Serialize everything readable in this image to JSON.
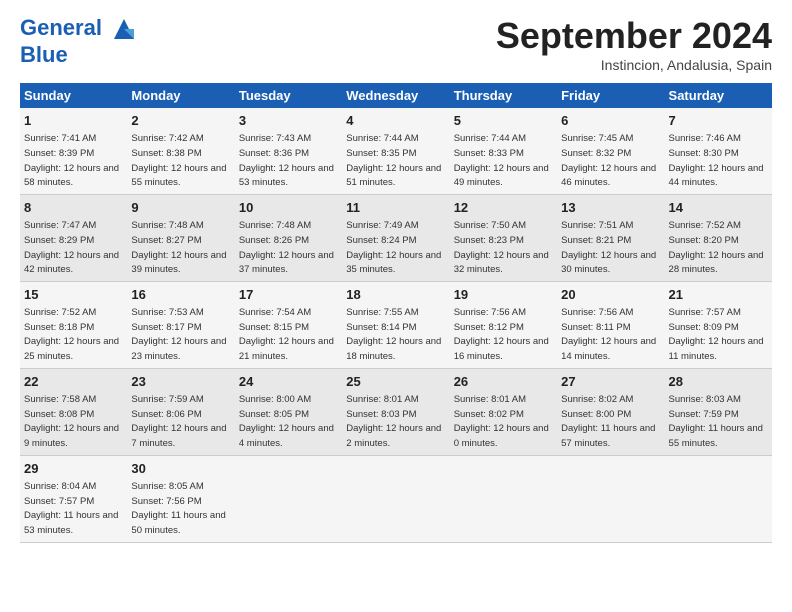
{
  "header": {
    "logo_line1": "General",
    "logo_line2": "Blue",
    "month": "September 2024",
    "location": "Instincion, Andalusia, Spain"
  },
  "days_of_week": [
    "Sunday",
    "Monday",
    "Tuesday",
    "Wednesday",
    "Thursday",
    "Friday",
    "Saturday"
  ],
  "weeks": [
    [
      {
        "day": "1",
        "sunrise": "Sunrise: 7:41 AM",
        "sunset": "Sunset: 8:39 PM",
        "daylight": "Daylight: 12 hours and 58 minutes."
      },
      {
        "day": "2",
        "sunrise": "Sunrise: 7:42 AM",
        "sunset": "Sunset: 8:38 PM",
        "daylight": "Daylight: 12 hours and 55 minutes."
      },
      {
        "day": "3",
        "sunrise": "Sunrise: 7:43 AM",
        "sunset": "Sunset: 8:36 PM",
        "daylight": "Daylight: 12 hours and 53 minutes."
      },
      {
        "day": "4",
        "sunrise": "Sunrise: 7:44 AM",
        "sunset": "Sunset: 8:35 PM",
        "daylight": "Daylight: 12 hours and 51 minutes."
      },
      {
        "day": "5",
        "sunrise": "Sunrise: 7:44 AM",
        "sunset": "Sunset: 8:33 PM",
        "daylight": "Daylight: 12 hours and 49 minutes."
      },
      {
        "day": "6",
        "sunrise": "Sunrise: 7:45 AM",
        "sunset": "Sunset: 8:32 PM",
        "daylight": "Daylight: 12 hours and 46 minutes."
      },
      {
        "day": "7",
        "sunrise": "Sunrise: 7:46 AM",
        "sunset": "Sunset: 8:30 PM",
        "daylight": "Daylight: 12 hours and 44 minutes."
      }
    ],
    [
      {
        "day": "8",
        "sunrise": "Sunrise: 7:47 AM",
        "sunset": "Sunset: 8:29 PM",
        "daylight": "Daylight: 12 hours and 42 minutes."
      },
      {
        "day": "9",
        "sunrise": "Sunrise: 7:48 AM",
        "sunset": "Sunset: 8:27 PM",
        "daylight": "Daylight: 12 hours and 39 minutes."
      },
      {
        "day": "10",
        "sunrise": "Sunrise: 7:48 AM",
        "sunset": "Sunset: 8:26 PM",
        "daylight": "Daylight: 12 hours and 37 minutes."
      },
      {
        "day": "11",
        "sunrise": "Sunrise: 7:49 AM",
        "sunset": "Sunset: 8:24 PM",
        "daylight": "Daylight: 12 hours and 35 minutes."
      },
      {
        "day": "12",
        "sunrise": "Sunrise: 7:50 AM",
        "sunset": "Sunset: 8:23 PM",
        "daylight": "Daylight: 12 hours and 32 minutes."
      },
      {
        "day": "13",
        "sunrise": "Sunrise: 7:51 AM",
        "sunset": "Sunset: 8:21 PM",
        "daylight": "Daylight: 12 hours and 30 minutes."
      },
      {
        "day": "14",
        "sunrise": "Sunrise: 7:52 AM",
        "sunset": "Sunset: 8:20 PM",
        "daylight": "Daylight: 12 hours and 28 minutes."
      }
    ],
    [
      {
        "day": "15",
        "sunrise": "Sunrise: 7:52 AM",
        "sunset": "Sunset: 8:18 PM",
        "daylight": "Daylight: 12 hours and 25 minutes."
      },
      {
        "day": "16",
        "sunrise": "Sunrise: 7:53 AM",
        "sunset": "Sunset: 8:17 PM",
        "daylight": "Daylight: 12 hours and 23 minutes."
      },
      {
        "day": "17",
        "sunrise": "Sunrise: 7:54 AM",
        "sunset": "Sunset: 8:15 PM",
        "daylight": "Daylight: 12 hours and 21 minutes."
      },
      {
        "day": "18",
        "sunrise": "Sunrise: 7:55 AM",
        "sunset": "Sunset: 8:14 PM",
        "daylight": "Daylight: 12 hours and 18 minutes."
      },
      {
        "day": "19",
        "sunrise": "Sunrise: 7:56 AM",
        "sunset": "Sunset: 8:12 PM",
        "daylight": "Daylight: 12 hours and 16 minutes."
      },
      {
        "day": "20",
        "sunrise": "Sunrise: 7:56 AM",
        "sunset": "Sunset: 8:11 PM",
        "daylight": "Daylight: 12 hours and 14 minutes."
      },
      {
        "day": "21",
        "sunrise": "Sunrise: 7:57 AM",
        "sunset": "Sunset: 8:09 PM",
        "daylight": "Daylight: 12 hours and 11 minutes."
      }
    ],
    [
      {
        "day": "22",
        "sunrise": "Sunrise: 7:58 AM",
        "sunset": "Sunset: 8:08 PM",
        "daylight": "Daylight: 12 hours and 9 minutes."
      },
      {
        "day": "23",
        "sunrise": "Sunrise: 7:59 AM",
        "sunset": "Sunset: 8:06 PM",
        "daylight": "Daylight: 12 hours and 7 minutes."
      },
      {
        "day": "24",
        "sunrise": "Sunrise: 8:00 AM",
        "sunset": "Sunset: 8:05 PM",
        "daylight": "Daylight: 12 hours and 4 minutes."
      },
      {
        "day": "25",
        "sunrise": "Sunrise: 8:01 AM",
        "sunset": "Sunset: 8:03 PM",
        "daylight": "Daylight: 12 hours and 2 minutes."
      },
      {
        "day": "26",
        "sunrise": "Sunrise: 8:01 AM",
        "sunset": "Sunset: 8:02 PM",
        "daylight": "Daylight: 12 hours and 0 minutes."
      },
      {
        "day": "27",
        "sunrise": "Sunrise: 8:02 AM",
        "sunset": "Sunset: 8:00 PM",
        "daylight": "Daylight: 11 hours and 57 minutes."
      },
      {
        "day": "28",
        "sunrise": "Sunrise: 8:03 AM",
        "sunset": "Sunset: 7:59 PM",
        "daylight": "Daylight: 11 hours and 55 minutes."
      }
    ],
    [
      {
        "day": "29",
        "sunrise": "Sunrise: 8:04 AM",
        "sunset": "Sunset: 7:57 PM",
        "daylight": "Daylight: 11 hours and 53 minutes."
      },
      {
        "day": "30",
        "sunrise": "Sunrise: 8:05 AM",
        "sunset": "Sunset: 7:56 PM",
        "daylight": "Daylight: 11 hours and 50 minutes."
      },
      null,
      null,
      null,
      null,
      null
    ]
  ]
}
